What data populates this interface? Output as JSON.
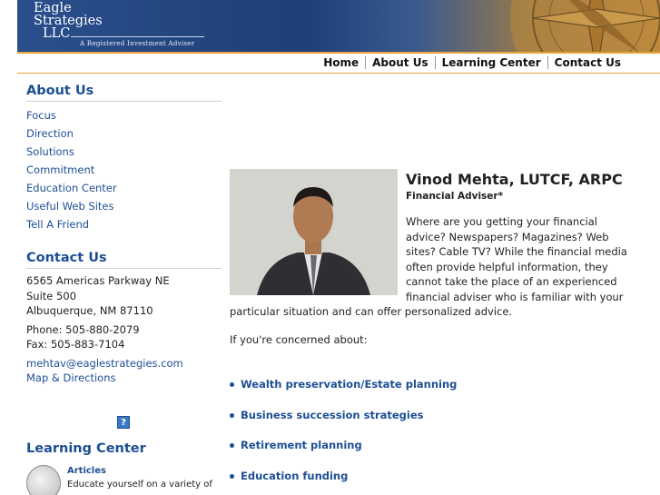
{
  "brand": {
    "line1": "Eagle",
    "line2": "Strategies",
    "line3": "LLC",
    "tagline": "A Registered Investment Adviser"
  },
  "nav": [
    "Home",
    "About Us",
    "Learning Center",
    "Contact Us"
  ],
  "sidebar": {
    "about_heading": "About Us",
    "about_links": [
      "Focus",
      "Direction",
      "Solutions",
      "Commitment",
      "Education Center",
      "Useful Web Sites",
      "Tell A Friend"
    ],
    "contact_heading": "Contact Us",
    "address1": "6565 Americas Parkway NE",
    "address2": "Suite 500",
    "address3": "Albuquerque, NM 87110",
    "phone": "Phone: 505-880-2079",
    "fax": "Fax: 505-883-7104",
    "email": "mehtav@eaglestrategies.com",
    "map": "Map & Directions",
    "help_icon": "?",
    "learning_heading": "Learning Center",
    "articles_title": "Articles",
    "articles_desc": "Educate yourself on a variety of"
  },
  "main": {
    "name": "Vinod Mehta, LUTCF, ARPC",
    "role": "Financial Adviser*",
    "intro": "Where are you getting your financial advice? Newspapers? Magazines? Web sites? Cable TV? While the financial media often provide helpful information, they cannot take the place of an experienced financial adviser who is familiar with your particular situation and can offer personalized advice.",
    "concerned": "If you're concerned about:",
    "concerns": [
      "Wealth preservation/Estate planning",
      "Business succession strategies",
      "Retirement planning",
      "Education funding"
    ]
  },
  "colors": {
    "link": "#1d4f94",
    "accent": "#e8a23a",
    "banner": "#1e3f77"
  }
}
